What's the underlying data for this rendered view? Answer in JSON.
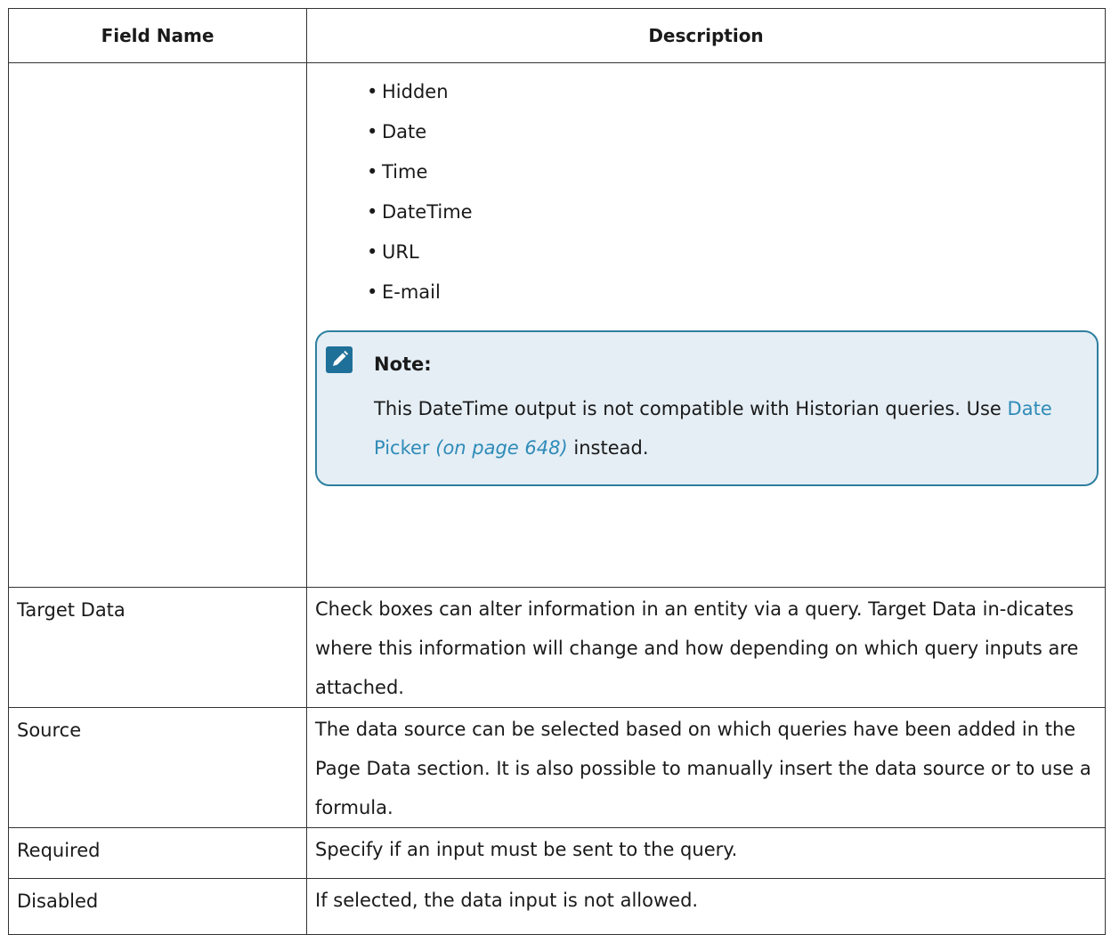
{
  "table": {
    "header": {
      "field_name": "Field Name",
      "description": "Description"
    },
    "types_row": {
      "items": [
        "Hidden",
        "Date",
        "Time",
        "DateTime",
        "URL",
        "E-mail"
      ],
      "note": {
        "label": "Note:",
        "text_before": "This DateTime output is not compatible with Historian queries. Use",
        "link_text": "Date Picker",
        "link_page": "(on page 648)",
        "text_after": "instead."
      }
    },
    "rows": [
      {
        "field": "Target Data",
        "description": "Check boxes can alter information in an entity via a query. Target Data in-dicates where this information will change and how depending on which query inputs are attached."
      },
      {
        "field": "Source",
        "description": "The data source can be selected based on which queries have been added in the Page Data section. It is also possible to manually insert the data source or to use a formula."
      },
      {
        "field": "Required",
        "description": "Specify if an input must be sent to the query."
      },
      {
        "field": "Disabled",
        "description": "If selected, the data input is not allowed."
      }
    ]
  },
  "colors": {
    "note_border": "#2e7f9f",
    "note_background": "#e5eef5",
    "note_icon": "#1f7099",
    "link": "#2e8bb8"
  },
  "icons": {
    "note": "pencil-note-icon"
  }
}
